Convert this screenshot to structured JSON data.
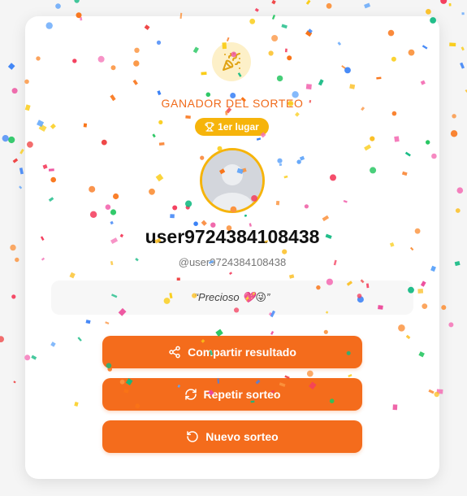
{
  "winner": {
    "title": "GANADOR DEL SORTEO",
    "place_badge": "1er lugar",
    "username": "user9724384108438",
    "handle": "@user9724384108438",
    "comment": "“Precioso 💖😜”"
  },
  "actions": {
    "share_label": "Compartir resultado",
    "repeat_label": "Repetir sorteo",
    "new_label": "Nuevo sorteo"
  },
  "icons": {
    "header": "party-popper-icon",
    "badge": "trophy-icon",
    "share": "share-icon",
    "repeat": "refresh-icon",
    "new": "rotate-ccw-icon"
  },
  "colors": {
    "accent": "#f46c1c",
    "title": "#f06a1a",
    "badge": "#f6b40b",
    "badge_bg_soft": "#fdf0c8"
  }
}
